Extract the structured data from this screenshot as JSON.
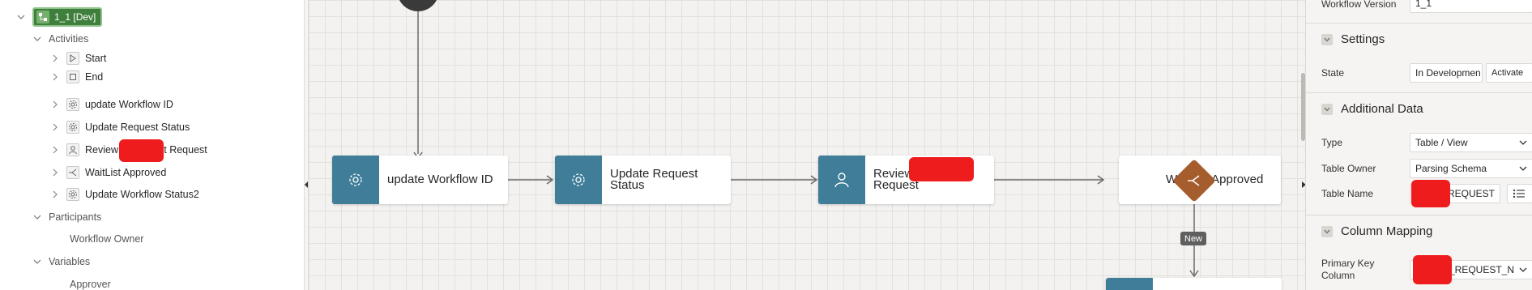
{
  "tree": {
    "root_label": "1_1 [Dev]",
    "groups": {
      "activities": "Activities",
      "participants": "Participants",
      "variables": "Variables"
    },
    "activities": [
      {
        "label": "Start",
        "icon": "start-play-icon"
      },
      {
        "label": "End",
        "icon": "end-square-icon"
      },
      {
        "label": "update Workflow ID",
        "icon": "gear-icon"
      },
      {
        "label": "Update Request Status",
        "icon": "gear-icon"
      },
      {
        "label": "Review",
        "label_tail": "st Request",
        "icon": "person-icon"
      },
      {
        "label": "WaitList Approved",
        "icon": "switch-icon"
      },
      {
        "label": "Update Workflow Status2",
        "icon": "gear-icon"
      }
    ],
    "participants": [
      "Workflow Owner"
    ],
    "variables": [
      "Approver"
    ]
  },
  "canvas": {
    "nodes": [
      {
        "label": "update Workflow ID",
        "icon": "gear-icon"
      },
      {
        "label_line1": "Update Request",
        "label_line2": "Status",
        "icon": "gear-icon"
      },
      {
        "label_line1": "Review",
        "label_line2": "Request",
        "icon": "person-icon"
      },
      {
        "label": "WaitList Approved",
        "icon": "switch-diamond-icon"
      }
    ],
    "edge_label": "New",
    "colors": {
      "activity": "#3f7d99",
      "switch": "#a65d2e",
      "edge": "#6b6b6b"
    }
  },
  "props": {
    "workflow_version_label": "Workflow Version",
    "workflow_version_value": "1_1",
    "settings": {
      "title": "Settings",
      "state_label": "State",
      "state_value": "In Developmen",
      "activate_label": "Activate"
    },
    "additional": {
      "title": "Additional Data",
      "type_label": "Type",
      "type_value": "Table / View",
      "owner_label": "Table Owner",
      "owner_value": "Parsing Schema",
      "name_label": "Table Name",
      "name_value": "_REQUEST"
    },
    "mapping": {
      "title": "Column Mapping",
      "pk_label_1": "Primary Key",
      "pk_label_2": "Column",
      "pk_value": "_REQUEST_N"
    }
  }
}
